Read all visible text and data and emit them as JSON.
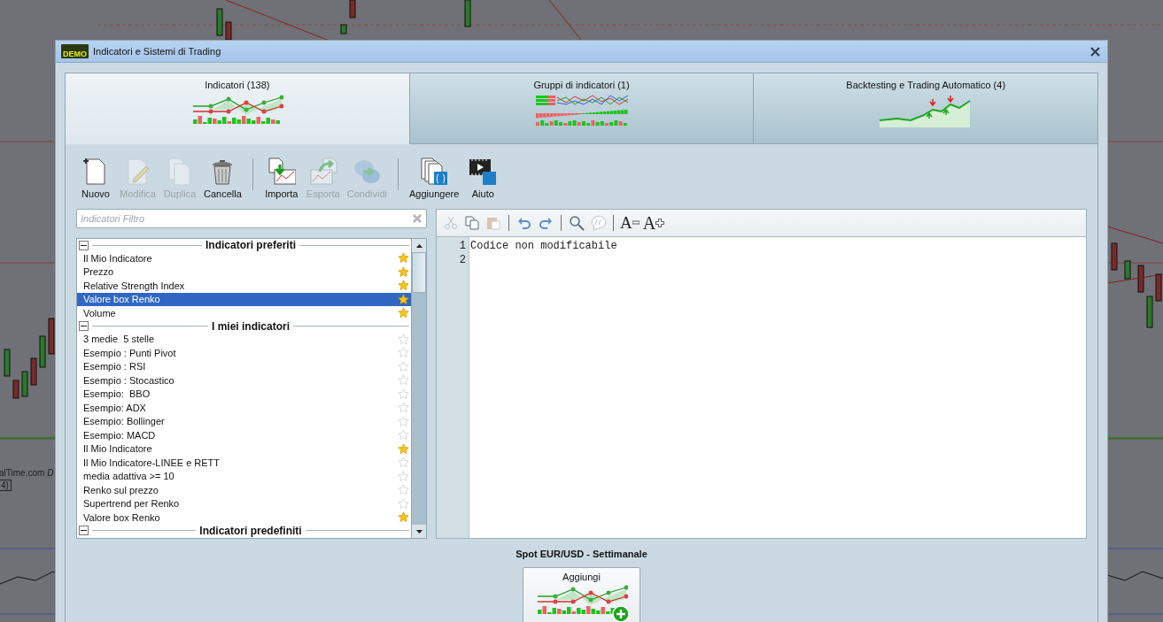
{
  "background": {
    "texts": [
      "alTime.com",
      "D",
      "4)"
    ]
  },
  "window": {
    "title": "Indicatori e Sistemi di Trading",
    "logo": "DEMO"
  },
  "tabs": [
    {
      "label": "Indicatori (138)",
      "selected": true,
      "kind": "indicators"
    },
    {
      "label": "Gruppi di indicatori (1)",
      "selected": false,
      "kind": "groups"
    },
    {
      "label": "Backtesting e Trading Automatico (4)",
      "selected": false,
      "kind": "backtest"
    }
  ],
  "toolbar": {
    "groups": [
      [
        {
          "label": "Nuovo",
          "kind": "new",
          "disabled": false
        },
        {
          "label": "Modifica",
          "kind": "edit",
          "disabled": true
        },
        {
          "label": "Duplica",
          "kind": "duplicate",
          "disabled": true
        },
        {
          "label": "Cancella",
          "kind": "trash",
          "disabled": false
        }
      ],
      [
        {
          "label": "Importa",
          "kind": "import",
          "disabled": false
        },
        {
          "label": "Esporta",
          "kind": "export",
          "disabled": true
        },
        {
          "label": "Condividi",
          "kind": "share",
          "disabled": true
        }
      ],
      [
        {
          "label": "Aggiungere",
          "kind": "add",
          "disabled": false
        },
        {
          "label": "Aiuto",
          "kind": "help",
          "disabled": false
        }
      ]
    ]
  },
  "filter": {
    "placeholder": "Indicatori Filtro"
  },
  "sections": [
    {
      "title": "Indicatori preferiti",
      "expanded": true,
      "items": [
        {
          "name": "Il Mio Indicatore",
          "favorite": true,
          "selected": false
        },
        {
          "name": "Prezzo",
          "favorite": true,
          "selected": false
        },
        {
          "name": "Relative Strength Index",
          "favorite": true,
          "selected": false
        },
        {
          "name": "Valore box Renko",
          "favorite": true,
          "selected": true
        },
        {
          "name": "Volume",
          "favorite": true,
          "selected": false
        }
      ]
    },
    {
      "title": "I miei indicatori",
      "expanded": true,
      "items": [
        {
          "name": "3 medie  5 stelle",
          "favorite": false,
          "selected": false
        },
        {
          "name": "Esempio : Punti Pivot",
          "favorite": false,
          "selected": false
        },
        {
          "name": "Esempio : RSI",
          "favorite": false,
          "selected": false
        },
        {
          "name": "Esempio : Stocastico",
          "favorite": false,
          "selected": false
        },
        {
          "name": "Esempio:  BBO",
          "favorite": false,
          "selected": false
        },
        {
          "name": "Esempio: ADX",
          "favorite": false,
          "selected": false
        },
        {
          "name": "Esempio: Bollinger",
          "favorite": false,
          "selected": false
        },
        {
          "name": "Esempio: MACD",
          "favorite": false,
          "selected": false
        },
        {
          "name": "Il Mio Indicatore",
          "favorite": true,
          "selected": false
        },
        {
          "name": "Il Mio Indicatore-LINEE e RETT",
          "favorite": false,
          "selected": false
        },
        {
          "name": "media adattiva >= 10",
          "favorite": false,
          "selected": false
        },
        {
          "name": "Renko sul prezzo",
          "favorite": false,
          "selected": false
        },
        {
          "name": "Supertrend per Renko",
          "favorite": false,
          "selected": false
        },
        {
          "name": "Valore box Renko",
          "favorite": true,
          "selected": false
        }
      ]
    },
    {
      "title": "Indicatori predefiniti",
      "expanded": true
    }
  ],
  "editor": {
    "tools": [
      {
        "kind": "cut",
        "disabled": true
      },
      {
        "kind": "copy",
        "disabled": false
      },
      {
        "kind": "paste",
        "disabled": true
      },
      {
        "kind": "sep"
      },
      {
        "kind": "undo",
        "disabled": false
      },
      {
        "kind": "redo",
        "disabled": false
      },
      {
        "kind": "sep"
      },
      {
        "kind": "search",
        "disabled": false
      },
      {
        "kind": "comment",
        "disabled": true
      },
      {
        "kind": "sep"
      },
      {
        "kind": "font-smaller",
        "glyph": "A",
        "disabled": false
      },
      {
        "kind": "font-larger",
        "glyph": "A",
        "disabled": false
      }
    ],
    "lines": [
      {
        "number": "1",
        "text": "Codice non modificabile"
      },
      {
        "number": "2"
      }
    ]
  },
  "footer": {
    "title": "Spot EUR/USD - Settimanale",
    "button": "Aggiungi"
  }
}
